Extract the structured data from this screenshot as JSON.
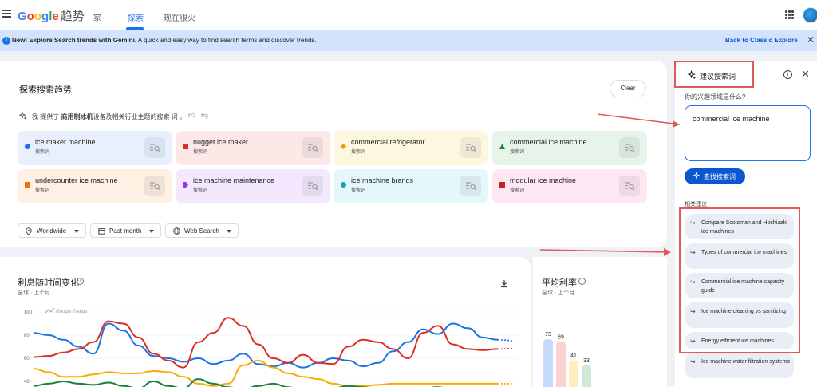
{
  "header": {
    "logo_google": "Google",
    "logo_trends": "趋势",
    "tabs": [
      {
        "label": "家"
      },
      {
        "label": "探索"
      },
      {
        "label": "现在很火"
      }
    ]
  },
  "banner": {
    "bold_text": "New! Explore Search trends with Gemini.",
    "text": " A quick and easy way to find search terms and discover trends.",
    "link_label": "Back to Classic Explore"
  },
  "explore": {
    "title": "探索搜索趋势",
    "clear_label": "Clear",
    "ai_note_prefix": "我 提供了 ",
    "ai_note_bold": "商用制冰机",
    "ai_note_suffix": "设备及相关行业主题的搜索 词 。",
    "terms": [
      {
        "label": "ice maker machine",
        "sub": "搜索词",
        "color": "#1a73e8",
        "bg": "#e8f0fe",
        "shape": "circle"
      },
      {
        "label": "nugget ice maker",
        "sub": "搜索词",
        "color": "#d93025",
        "bg": "#fce8e6",
        "shape": "square"
      },
      {
        "label": "commercial refrigerator",
        "sub": "搜索词",
        "color": "#f29900",
        "bg": "#fef7e0",
        "shape": "diamond"
      },
      {
        "label": "commercial ice machine",
        "sub": "搜索词",
        "color": "#188038",
        "bg": "#e6f4ea",
        "shape": "triangle"
      },
      {
        "label": "undercounter ice machine",
        "sub": "搜索词",
        "color": "#e8710a",
        "bg": "#fef0e3",
        "shape": "square"
      },
      {
        "label": "ice machine maintenance",
        "sub": "搜索词",
        "color": "#9334e6",
        "bg": "#f3e8fd",
        "shape": "tag"
      },
      {
        "label": "ice machine brands",
        "sub": "搜索词",
        "color": "#12a4af",
        "bg": "#e4f7fb",
        "shape": "circle"
      },
      {
        "label": "modular ice machine",
        "sub": "搜索词",
        "color": "#c5221f",
        "bg": "#fde7f3",
        "shape": "square"
      }
    ],
    "filters": [
      {
        "label": "Worldwide",
        "icon": "location-pin-icon"
      },
      {
        "label": "Past month",
        "icon": "calendar-icon"
      },
      {
        "label": "Web Search",
        "icon": "globe-icon"
      }
    ]
  },
  "interest_chart": {
    "title": "利息随时间变化",
    "subtitle": "全球 · 上个月",
    "watermark": "Google Trends",
    "y_ticks": [
      "100",
      "80",
      "60",
      "40"
    ]
  },
  "chart_data": {
    "type": "line",
    "title": "利息随时间变化",
    "ylim": [
      40,
      100
    ],
    "series": [
      {
        "color": "#1a73e8",
        "values": [
          82,
          80,
          76,
          70,
          64,
          90,
          84,
          71,
          62,
          60,
          57,
          60,
          55,
          58,
          64,
          55,
          53,
          56,
          52,
          56,
          60,
          58,
          53,
          56,
          66,
          74,
          85,
          81,
          90,
          86,
          78,
          76
        ]
      },
      {
        "color": "#d93025",
        "values": [
          61,
          62,
          65,
          68,
          74,
          92,
          90,
          78,
          64,
          58,
          52,
          74,
          82,
          95,
          88,
          72,
          60,
          56,
          63,
          56,
          55,
          70,
          76,
          74,
          68,
          60,
          82,
          88,
          72,
          68,
          67,
          68
        ]
      },
      {
        "color": "#f9ab00",
        "values": [
          51,
          48,
          44,
          44,
          46,
          48,
          47,
          47,
          49,
          48,
          44,
          38,
          36,
          38,
          54,
          58,
          52,
          47,
          44,
          42,
          38,
          36,
          36,
          37,
          38,
          38,
          38,
          38,
          38,
          38,
          38,
          38
        ]
      },
      {
        "color": "#188038",
        "values": [
          36,
          38,
          40,
          38,
          37,
          39,
          36,
          34,
          40,
          36,
          34,
          42,
          38,
          35,
          33,
          36,
          38,
          35,
          32,
          33,
          34,
          36,
          35,
          33,
          32,
          33,
          34,
          35,
          33,
          34,
          34,
          34
        ]
      }
    ]
  },
  "avg_chart": {
    "title": "平均利率",
    "subtitle": "全球 · 上个月",
    "bars": [
      {
        "value": 73,
        "color": "#c6dafc"
      },
      {
        "value": 69,
        "color": "#fad2cf"
      },
      {
        "value": 41,
        "color": "#feefc3"
      },
      {
        "value": 33,
        "color": "#ceead6"
      }
    ]
  },
  "side_panel": {
    "title": "建议搜索词",
    "question": "你的兴趣领域是什么?",
    "input_value": "commercial ice machine",
    "search_label": "查找搜索词",
    "related_label": "相关建议",
    "suggestions": [
      "Compare Scotsman and Hoshizaki ice machines",
      "Types of commercial ice machines",
      "Commercial ice machine capacity guide",
      "Ice machine cleaning vs sanitizing",
      "Energy efficient ice machines",
      "Ice machine water filtration systems"
    ]
  }
}
